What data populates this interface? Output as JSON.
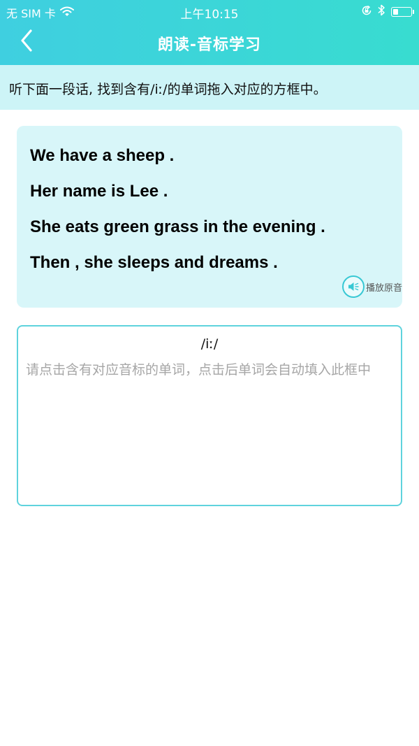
{
  "status_bar": {
    "carrier": "无 SIM 卡",
    "time": "上午10:15"
  },
  "nav": {
    "title": "朗读-音标学习"
  },
  "instruction": "听下面一段话, 找到含有/iː/的单词拖入对应的方框中。",
  "passage": {
    "lines": [
      "We have a sheep .",
      "Her name is Lee .",
      "She eats green grass in the evening .",
      "Then , she sleeps and dreams ."
    ],
    "play_label": "播放原音"
  },
  "answer_box": {
    "phonetic": "/iː/",
    "placeholder": "请点击含有对应音标的单词，点击后单词会自动填入此框中"
  },
  "colors": {
    "header_start": "#3fcfe0",
    "header_end": "#38dcd0",
    "instruction_bg": "#cdf4f7",
    "card_bg": "#d8f6f9",
    "accent": "#38c8d4"
  },
  "icons": {
    "back": "chevron-left-icon",
    "wifi": "wifi-icon",
    "lock_rotation": "orientation-lock-icon",
    "bluetooth": "bluetooth-icon",
    "battery": "battery-icon",
    "speaker": "speaker-icon"
  }
}
